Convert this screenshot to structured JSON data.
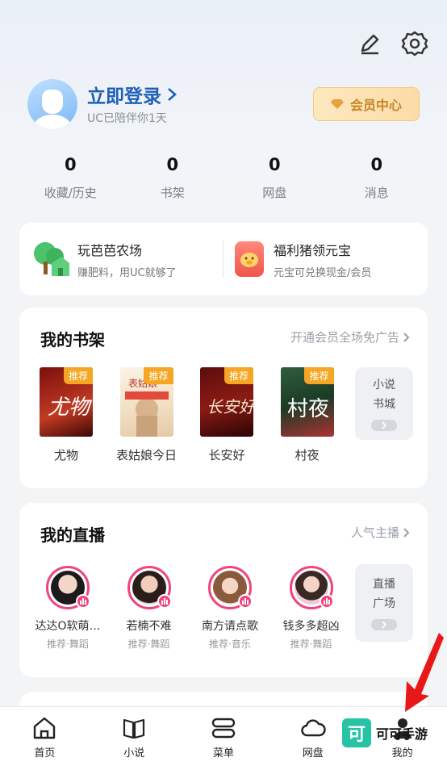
{
  "login": {
    "title": "立即登录",
    "subtitle": "UC已陪伴你1天"
  },
  "vip": {
    "label": "会员中心"
  },
  "stats": [
    {
      "value": "0",
      "label": "收藏/历史"
    },
    {
      "value": "0",
      "label": "书架"
    },
    {
      "value": "0",
      "label": "网盘"
    },
    {
      "value": "0",
      "label": "消息"
    }
  ],
  "promo": [
    {
      "title": "玩芭芭农场",
      "desc": "赚肥料，用UC就够了"
    },
    {
      "title": "福利猪领元宝",
      "desc": "元宝可兑换现金/会员"
    }
  ],
  "bookshelf": {
    "title": "我的书架",
    "link": "开通会员全场免广告",
    "tag": "推荐",
    "books": [
      {
        "name": "尤物",
        "cover_text": "尤物"
      },
      {
        "name": "表姑娘今日",
        "cover_text": "表姑娘"
      },
      {
        "name": "长安好",
        "cover_text": "长安好"
      },
      {
        "name": "村夜",
        "cover_text": "村夜"
      }
    ],
    "store": {
      "line1": "小说",
      "line2": "书城"
    }
  },
  "live": {
    "title": "我的直播",
    "link": "人气主播",
    "streamers": [
      {
        "name": "达达O软萌…",
        "category": "推荐·舞蹈"
      },
      {
        "name": "若楠不难",
        "category": "推荐·舞蹈"
      },
      {
        "name": "南方请点歌",
        "category": "推荐·音乐"
      },
      {
        "name": "钱多多超凶",
        "category": "推荐·舞蹈"
      }
    ],
    "plaza": {
      "line1": "直播",
      "line2": "广场"
    }
  },
  "tabs": [
    {
      "label": "首页",
      "icon": "home-icon"
    },
    {
      "label": "小说",
      "icon": "book-icon"
    },
    {
      "label": "菜单",
      "icon": "menu-icon"
    },
    {
      "label": "网盘",
      "icon": "cloud-icon"
    },
    {
      "label": "我的",
      "icon": "profile-icon"
    }
  ],
  "watermark": {
    "logo": "可",
    "text": "可可手游"
  },
  "colors": {
    "accent": "#1f5fb7",
    "vip_gold": "#c98523",
    "live_pink": "#f0457c",
    "tag_orange": "#f5a623"
  }
}
